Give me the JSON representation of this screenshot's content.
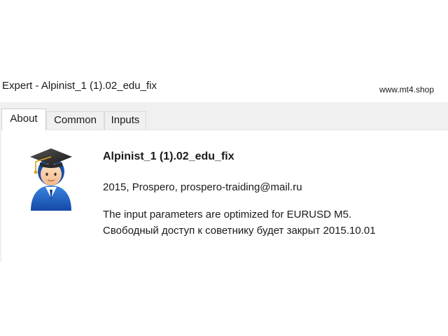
{
  "window": {
    "title": "Expert - Alpinist_1 (1).02_edu_fix",
    "watermark": "www.mt4.shop"
  },
  "tabs": [
    {
      "label": "About",
      "active": true
    },
    {
      "label": "Common",
      "active": false
    },
    {
      "label": "Inputs",
      "active": false
    }
  ],
  "about": {
    "icon": "expert-graduate-avatar-icon",
    "name": "Alpinist_1 (1).02_edu_fix",
    "author_line": "2015, Prospero, prospero-traiding@mail.ru",
    "description_lines": [
      "The input parameters are optimized for EURUSD M5.",
      "Свободный доступ к советнику будет закрыт 2015.10.01"
    ]
  },
  "colors": {
    "window_bg": "#f0f0f0",
    "panel_bg": "#ffffff",
    "avatar_blue": "#1f5fbf",
    "cap_black": "#2b2b2b"
  }
}
